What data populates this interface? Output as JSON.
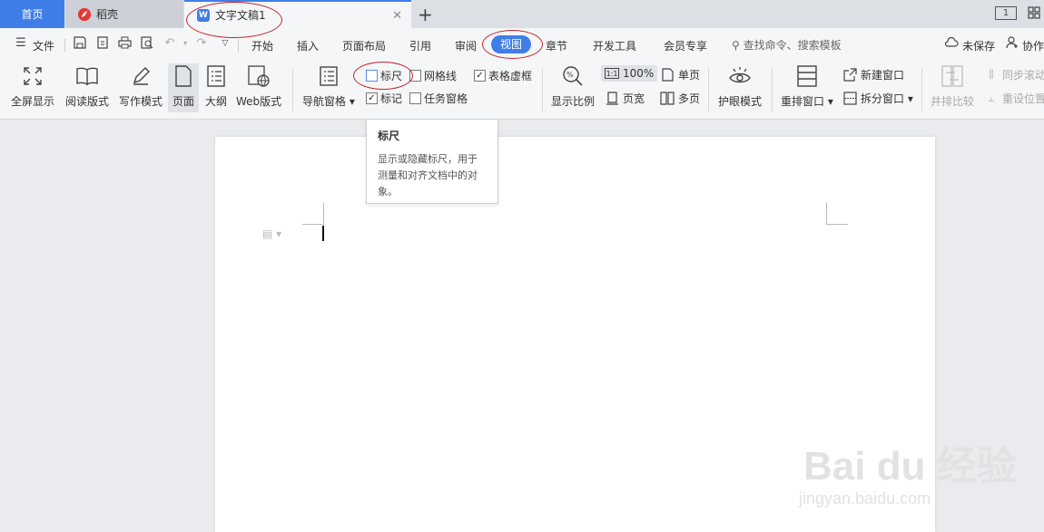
{
  "tabs": {
    "home": "首页",
    "daoke": "稻壳",
    "document": "文字文稿1",
    "window_page_indicator": "1"
  },
  "menu": {
    "file": "文件",
    "tabs": [
      "开始",
      "插入",
      "页面布局",
      "引用",
      "审阅",
      "视图",
      "章节",
      "开发工具",
      "会员专享"
    ],
    "active_tab": "视图",
    "search_placeholder": "查找命令、搜索模板",
    "unsaved": "未保存",
    "collab": "协作"
  },
  "ribbon": {
    "fullscreen": "全屏显示",
    "reading": "阅读版式",
    "writing": "写作模式",
    "page": "页面",
    "outline": "大纲",
    "web": "Web版式",
    "nav_pane": "导航窗格",
    "ruler": "标尺",
    "gridlines": "网格线",
    "table_gridlines": "表格虚框",
    "markup": "标记",
    "task_pane": "任务窗格",
    "zoom": "显示比例",
    "zoom_100": "100%",
    "single_page": "单页",
    "page_width": "页宽",
    "multi_page": "多页",
    "eye_mode": "护眼模式",
    "rearrange": "重排窗口",
    "new_window": "新建窗口",
    "split_window": "拆分窗口",
    "side_by_side": "并排比较",
    "sync_scroll": "同步滚动",
    "reset_position": "重设位置"
  },
  "checkbox_states": {
    "ruler": false,
    "gridlines": false,
    "table_gridlines": true,
    "markup": true,
    "task_pane": false
  },
  "tooltip": {
    "title": "标尺",
    "body": "显示或隐藏标尺，用于测量和对齐文档中的对象。"
  },
  "watermark": {
    "brand": "Bai du 经验",
    "url": "jingyan.baidu.com"
  },
  "colors": {
    "accent": "#3f7ee8",
    "annotation": "#c0262d"
  }
}
